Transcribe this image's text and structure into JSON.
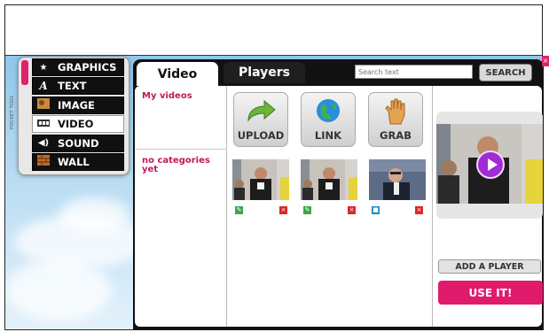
{
  "pocket_tool": {
    "label": "POCKET TOOL",
    "items": [
      {
        "label": "GRAPHICS",
        "icon": "star-icon"
      },
      {
        "label": "TEXT",
        "icon": "letter-a-icon"
      },
      {
        "label": "IMAGE",
        "icon": "image-icon"
      },
      {
        "label": "VIDEO",
        "icon": "film-icon",
        "active": true
      },
      {
        "label": "SOUND",
        "icon": "speaker-icon"
      },
      {
        "label": "WALL",
        "icon": "wall-icon"
      }
    ]
  },
  "tabs": {
    "video": "Video",
    "players": "Players"
  },
  "search": {
    "placeholder": "Search text",
    "button": "SEARCH"
  },
  "sidebar": {
    "my_videos": "My videos",
    "no_categories": "no categories yet"
  },
  "actions": {
    "upload": "UPLOAD",
    "link": "LINK",
    "grab": "GRAB"
  },
  "buttons": {
    "add_player": "ADD A PLAYER",
    "use_it": "USE IT!"
  },
  "colors": {
    "accent": "#e01b6c",
    "link_text": "#c2185b",
    "play": "#a22bd6",
    "panel": "#111111"
  }
}
